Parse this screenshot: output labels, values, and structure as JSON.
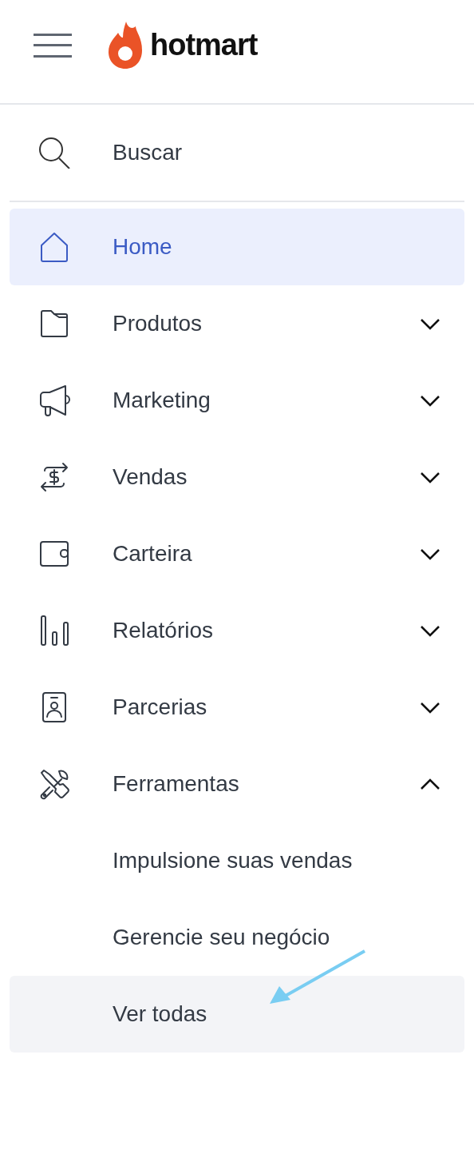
{
  "header": {
    "logo_text": "hotmart"
  },
  "search": {
    "label": "Buscar"
  },
  "nav": [
    {
      "label": "Home",
      "selected": true
    },
    {
      "label": "Produtos",
      "selected": false,
      "expanded": false
    },
    {
      "label": "Marketing",
      "selected": false,
      "expanded": false
    },
    {
      "label": "Vendas",
      "selected": false,
      "expanded": false
    },
    {
      "label": "Carteira",
      "selected": false,
      "expanded": false
    },
    {
      "label": "Relatórios",
      "selected": false,
      "expanded": false
    },
    {
      "label": "Parcerias",
      "selected": false,
      "expanded": false
    },
    {
      "label": "Ferramentas",
      "selected": false,
      "expanded": true,
      "children": [
        {
          "label": "Impulsione suas vendas",
          "hovered": false
        },
        {
          "label": "Gerencie seu negócio",
          "hovered": false
        },
        {
          "label": "Ver todas",
          "hovered": true
        }
      ]
    }
  ]
}
